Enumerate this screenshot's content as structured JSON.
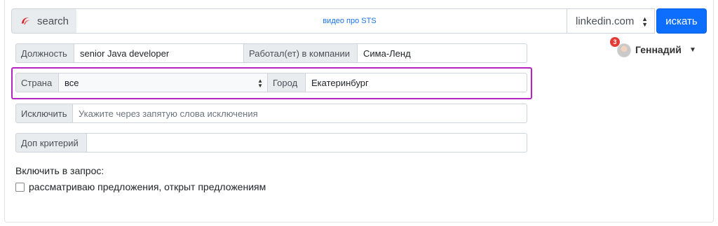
{
  "topbar": {
    "brand_label": "search",
    "brand_icon": "swirl-logo-icon",
    "video_link": "видео про STS",
    "site_selected": "linkedin.com",
    "search_button": "искать"
  },
  "user": {
    "notifications": "3",
    "name": "Геннадий"
  },
  "form": {
    "position_label": "Должность",
    "position_value": "senior Java developer",
    "company_label": "Работал(ет) в компании",
    "company_value": "Сима-Ленд",
    "country_label": "Страна",
    "country_value": "все",
    "city_label": "Город",
    "city_value": "Екатеринбург",
    "exclude_label": "Исключить",
    "exclude_placeholder": "Укажите через запятую слова исключения",
    "extra_label": "Доп критерий",
    "extra_value": ""
  },
  "include": {
    "heading": "Включить в запрос:",
    "option_label": "рассматриваю предложения, открыт предложениям",
    "option_checked": false
  },
  "colors": {
    "accent": "#0d6efd",
    "highlight": "#b523c2",
    "badge": "#e53935",
    "link": "#1a73e8"
  }
}
